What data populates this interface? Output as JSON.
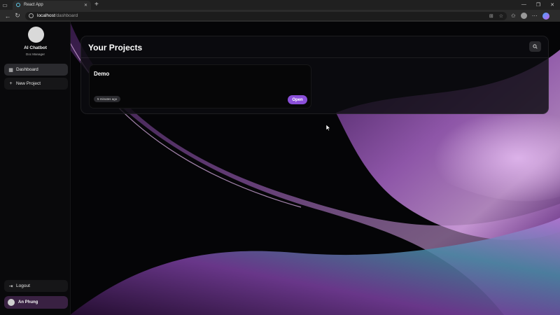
{
  "browser": {
    "tab_title": "React App",
    "tab_close": "✕",
    "new_tab": "+",
    "window_controls": [
      "—",
      "❐",
      "✕"
    ],
    "url_host": "localhost",
    "url_path": "/dashboard"
  },
  "sidebar": {
    "brand_title": "AI Chatbot",
    "brand_subtitle": "Doc Manager",
    "items": [
      {
        "label": "Dashboard",
        "icon": "dashboard-grid-icon",
        "active": true
      },
      {
        "label": "New Project",
        "icon": "plus-icon",
        "active": false
      }
    ],
    "logout_label": "Logout",
    "user_name": "An Phung"
  },
  "main": {
    "title": "Your Projects",
    "projects": [
      {
        "name": "Demo",
        "updated": "5 minutes ago",
        "open_label": "Open"
      }
    ]
  },
  "colors": {
    "accent": "#8a4fd8",
    "background": "#060608",
    "panel": "#0c0c10"
  }
}
